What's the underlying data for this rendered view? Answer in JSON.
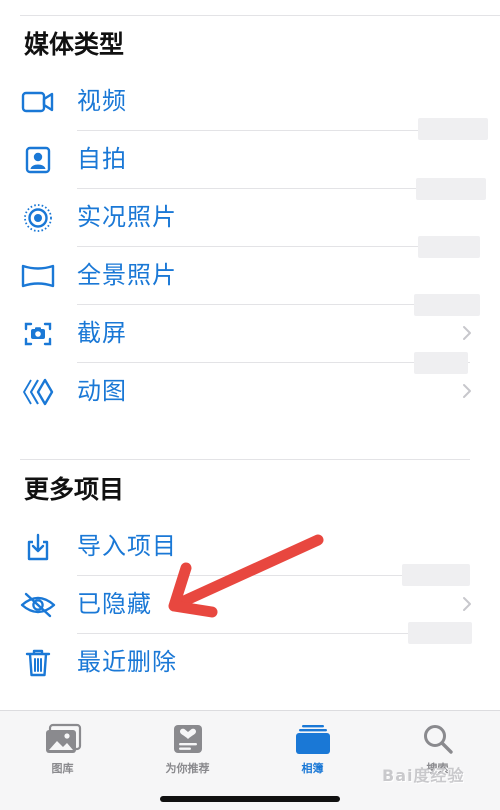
{
  "sections": [
    {
      "title": "媒体类型",
      "items": [
        {
          "label": "视频",
          "icon": "video-camera-icon"
        },
        {
          "label": "自拍",
          "icon": "selfie-portrait-icon"
        },
        {
          "label": "实况照片",
          "icon": "live-photo-icon"
        },
        {
          "label": "全景照片",
          "icon": "panorama-icon"
        },
        {
          "label": "截屏",
          "icon": "screenshot-icon"
        },
        {
          "label": "动图",
          "icon": "animated-icon"
        }
      ]
    },
    {
      "title": "更多项目",
      "items": [
        {
          "label": "导入项目",
          "icon": "import-icon"
        },
        {
          "label": "已隐藏",
          "icon": "hidden-eye-slash-icon"
        },
        {
          "label": "最近删除",
          "icon": "trash-icon"
        }
      ]
    }
  ],
  "tabbar": {
    "tabs": [
      {
        "label": "图库",
        "icon": "photo-library-icon",
        "active": false
      },
      {
        "label": "为你推荐",
        "icon": "for-you-icon",
        "active": false
      },
      {
        "label": "相簿",
        "icon": "albums-icon",
        "active": true
      },
      {
        "label": "搜索",
        "icon": "search-icon",
        "active": false
      }
    ]
  },
  "watermark": "Bai度经验",
  "colors": {
    "accent": "#1a78d6",
    "arrow": "#e8473f",
    "tab_inactive": "#8a8a8e",
    "divider": "#e3e3e6"
  }
}
